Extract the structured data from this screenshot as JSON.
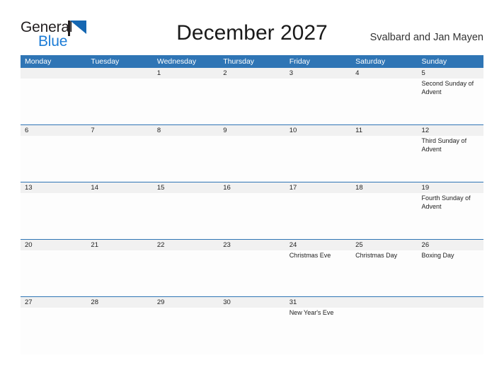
{
  "logo": {
    "word_top": "General",
    "word_bottom": "Blue",
    "flag_icon": "flag-triangle-icon",
    "color_blue": "#1567b2",
    "color_text_blue": "#1c7cd6",
    "color_dark": "#231f20"
  },
  "header": {
    "title": "December 2027",
    "region": "Svalbard and Jan Mayen",
    "accent_color": "#2f75b5",
    "band_color": "#f1f1f1"
  },
  "weekdays": [
    "Monday",
    "Tuesday",
    "Wednesday",
    "Thursday",
    "Friday",
    "Saturday",
    "Sunday"
  ],
  "weeks": [
    {
      "days": [
        {
          "num": "",
          "event": ""
        },
        {
          "num": "",
          "event": ""
        },
        {
          "num": "1",
          "event": ""
        },
        {
          "num": "2",
          "event": ""
        },
        {
          "num": "3",
          "event": ""
        },
        {
          "num": "4",
          "event": ""
        },
        {
          "num": "5",
          "event": "Second Sunday of Advent"
        }
      ]
    },
    {
      "days": [
        {
          "num": "6",
          "event": ""
        },
        {
          "num": "7",
          "event": ""
        },
        {
          "num": "8",
          "event": ""
        },
        {
          "num": "9",
          "event": ""
        },
        {
          "num": "10",
          "event": ""
        },
        {
          "num": "11",
          "event": ""
        },
        {
          "num": "12",
          "event": "Third Sunday of Advent"
        }
      ]
    },
    {
      "days": [
        {
          "num": "13",
          "event": ""
        },
        {
          "num": "14",
          "event": ""
        },
        {
          "num": "15",
          "event": ""
        },
        {
          "num": "16",
          "event": ""
        },
        {
          "num": "17",
          "event": ""
        },
        {
          "num": "18",
          "event": ""
        },
        {
          "num": "19",
          "event": "Fourth Sunday of Advent"
        }
      ]
    },
    {
      "days": [
        {
          "num": "20",
          "event": ""
        },
        {
          "num": "21",
          "event": ""
        },
        {
          "num": "22",
          "event": ""
        },
        {
          "num": "23",
          "event": ""
        },
        {
          "num": "24",
          "event": "Christmas Eve"
        },
        {
          "num": "25",
          "event": "Christmas Day"
        },
        {
          "num": "26",
          "event": "Boxing Day"
        }
      ]
    },
    {
      "days": [
        {
          "num": "27",
          "event": ""
        },
        {
          "num": "28",
          "event": ""
        },
        {
          "num": "29",
          "event": ""
        },
        {
          "num": "30",
          "event": ""
        },
        {
          "num": "31",
          "event": "New Year's Eve"
        },
        {
          "num": "",
          "event": ""
        },
        {
          "num": "",
          "event": ""
        }
      ]
    }
  ]
}
